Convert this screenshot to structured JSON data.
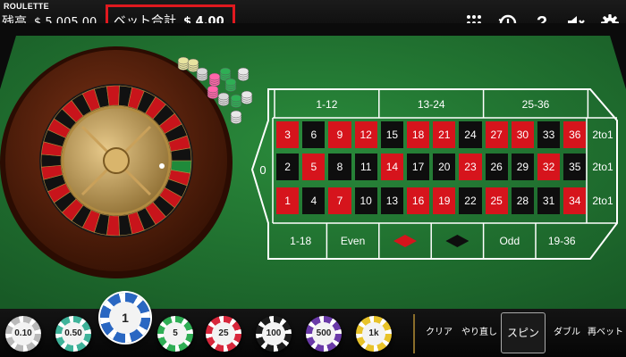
{
  "header": {
    "game_name": "ROULETTE",
    "balance_label": "残高",
    "balance_value": "$ 5 005.00",
    "total_bet_label": "ベット合計",
    "total_bet_value": "$ 4.00",
    "help_label": "?"
  },
  "icons": [
    "menu-dots-icon",
    "history-icon",
    "help-icon",
    "mute-icon",
    "settings-icon"
  ],
  "table": {
    "zero": "0",
    "rows": [
      [
        {
          "n": "3",
          "c": "red"
        },
        {
          "n": "6",
          "c": "black"
        },
        {
          "n": "9",
          "c": "red"
        },
        {
          "n": "12",
          "c": "red"
        },
        {
          "n": "15",
          "c": "black"
        },
        {
          "n": "18",
          "c": "red"
        },
        {
          "n": "21",
          "c": "red"
        },
        {
          "n": "24",
          "c": "black"
        },
        {
          "n": "27",
          "c": "red"
        },
        {
          "n": "30",
          "c": "red"
        },
        {
          "n": "33",
          "c": "black"
        },
        {
          "n": "36",
          "c": "red"
        }
      ],
      [
        {
          "n": "2",
          "c": "black"
        },
        {
          "n": "5",
          "c": "red"
        },
        {
          "n": "8",
          "c": "black"
        },
        {
          "n": "11",
          "c": "black"
        },
        {
          "n": "14",
          "c": "red"
        },
        {
          "n": "17",
          "c": "black"
        },
        {
          "n": "20",
          "c": "black"
        },
        {
          "n": "23",
          "c": "red"
        },
        {
          "n": "26",
          "c": "black"
        },
        {
          "n": "29",
          "c": "black"
        },
        {
          "n": "32",
          "c": "red"
        },
        {
          "n": "35",
          "c": "black"
        }
      ],
      [
        {
          "n": "1",
          "c": "red"
        },
        {
          "n": "4",
          "c": "black"
        },
        {
          "n": "7",
          "c": "red"
        },
        {
          "n": "10",
          "c": "black"
        },
        {
          "n": "13",
          "c": "black"
        },
        {
          "n": "16",
          "c": "red"
        },
        {
          "n": "19",
          "c": "red"
        },
        {
          "n": "22",
          "c": "black"
        },
        {
          "n": "25",
          "c": "red"
        },
        {
          "n": "28",
          "c": "black"
        },
        {
          "n": "31",
          "c": "black"
        },
        {
          "n": "34",
          "c": "red"
        }
      ]
    ],
    "dozens": [
      "1-12",
      "13-24",
      "25-36"
    ],
    "columns": [
      "2to1",
      "2to1",
      "2to1"
    ],
    "outside": [
      "1-18",
      "Even",
      "",
      "",
      "Odd",
      "19-36"
    ],
    "colors": {
      "felt": "#1f6b2e",
      "red": "#d6141c",
      "black": "#0e0e0e",
      "line": "#ffffff"
    }
  },
  "chips": [
    {
      "label": "0.10",
      "color": "#b9b9b9"
    },
    {
      "label": "0.50",
      "color": "#3fb39a"
    },
    {
      "label": "1",
      "color": "#2a67c2",
      "selected": true
    },
    {
      "label": "5",
      "color": "#2fae55"
    },
    {
      "label": "25",
      "color": "#d8273c"
    },
    {
      "label": "100",
      "color": "#1c1c1c"
    },
    {
      "label": "500",
      "color": "#6a3aa8"
    },
    {
      "label": "1k",
      "color": "#e8c32a"
    }
  ],
  "actions": [
    {
      "label": "クリア",
      "name": "clear-button"
    },
    {
      "label": "やり直し",
      "name": "undo-button"
    },
    {
      "label": "スピン",
      "name": "spin-button",
      "selected": true
    },
    {
      "label": "ダブル",
      "name": "double-button"
    },
    {
      "label": "再ベット",
      "name": "rebet-button"
    }
  ]
}
